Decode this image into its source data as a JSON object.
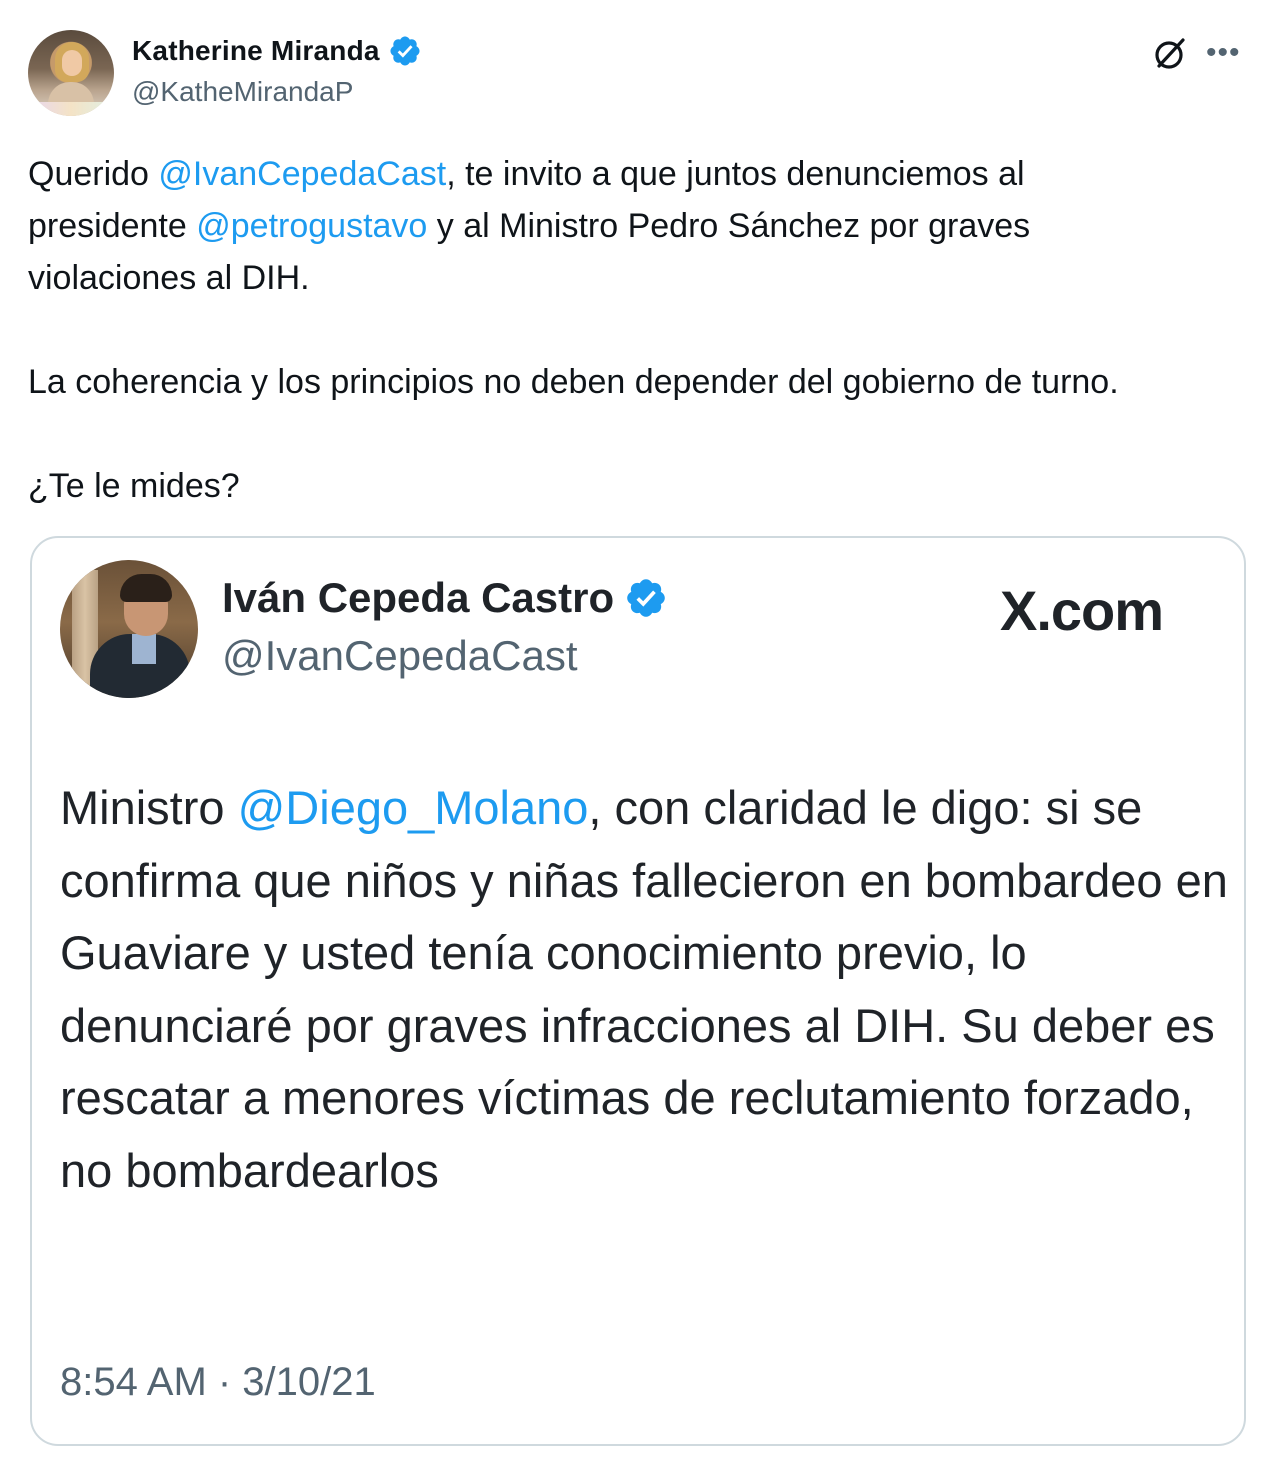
{
  "author": {
    "name": "Katherine Miranda",
    "handle": "@KatheMirandaP"
  },
  "post": {
    "line1": {
      "t1": "Querido ",
      "m1": "@IvanCepedaCast",
      "t2": ", te invito a que juntos denunciemos al"
    },
    "line2": {
      "t1": "presidente ",
      "m1": "@petrogustavo",
      "t2": " y al Ministro Pedro Sánchez por graves"
    },
    "line3": "violaciones al DIH.",
    "paragraph2": "La coherencia y los principios no deben depender del gobierno de turno.",
    "paragraph3": "¿Te le mides?"
  },
  "quoted": {
    "name": "Iván Cepeda Castro",
    "handle": "@IvanCepedaCast",
    "source": "X.com",
    "text_prefix": "Ministro ",
    "mention": "@Diego_Molano",
    "text_rest": ", con claridad le digo: si se confirma que niños y niñas fallecieron en bombardeo en Guaviare y usted tenía conocimiento previo, lo denunciaré por graves infracciones al DIH. Su deber es rescatar a menores víctimas de reclutamiento forzado, no bombardearlos",
    "timestamp": "8:54 AM · 3/10/21"
  },
  "icons": {
    "verified": "verified-badge-icon",
    "grok": "grok-icon",
    "more": "more-options-icon"
  },
  "colors": {
    "mention": "#1d9bf0",
    "verified": "#1d9bf0",
    "secondary_text": "#536471",
    "border": "#cfd9de"
  }
}
